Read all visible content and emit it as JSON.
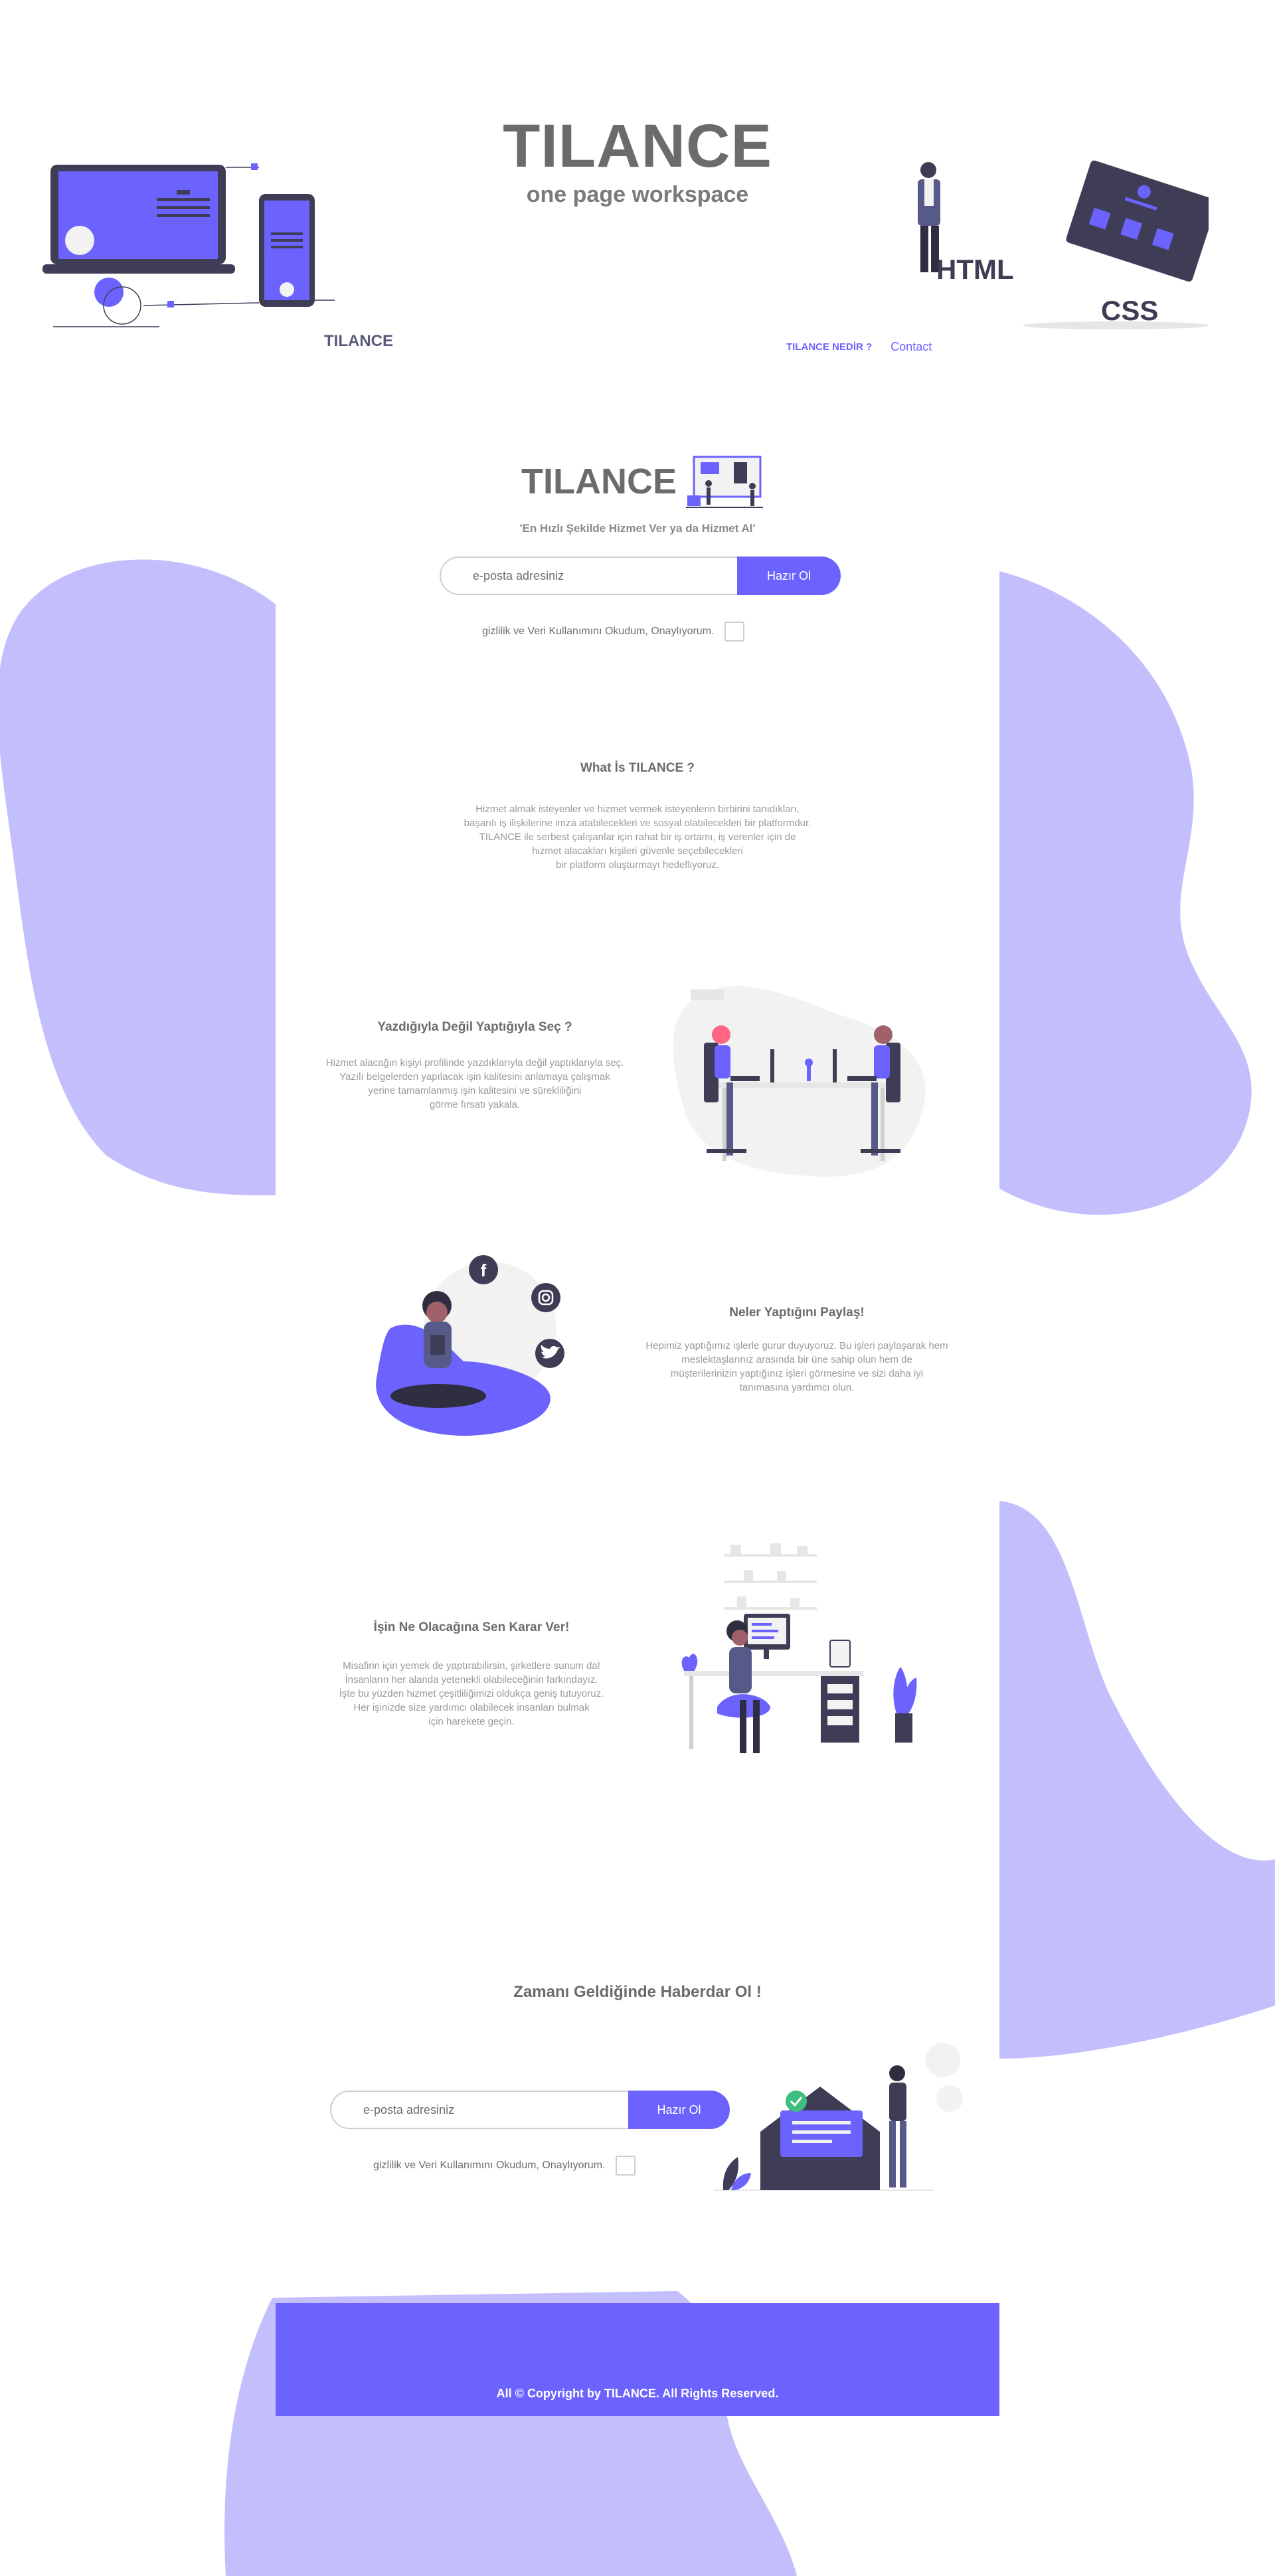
{
  "colors": {
    "accent": "#6c63ff",
    "blob": "#c3bffd",
    "dark": "#3f3d56",
    "title_grey": "#6b6b6b"
  },
  "header": {
    "title": "TILANCE",
    "subtitle": "one page workspace",
    "logo_text": "TILANCE",
    "nav": [
      {
        "label": "TILANCE NEDİR ?"
      },
      {
        "label": "Contact"
      }
    ],
    "illustration_left": "laptop-phone-illustration",
    "illustration_right": "html-css-illustration"
  },
  "hero": {
    "logo_text": "TILANCE",
    "tagline": "'En Hızlı Şekilde Hizmet Ver ya da Hizmet Al'",
    "email_placeholder": "e-posta adresiniz",
    "submit_label": "Hazır Ol",
    "consent_label": "gizlilik ve Veri Kullanımını Okudum, Onaylıyorum."
  },
  "what_is": {
    "title": "What İs TILANCE ?",
    "body": "Hizmet almak isteyenler ve hizmet vermek isteyenlerin birbirini tanıdıkları,\nbaşarılı iş ilişkilerine imza atabilecekleri ve sosyal olabilecekleri bir platformdur.\nTILANCE ile serbest çalışanlar için rahat bir iş ortamı, iş verenler için de\nhizmet alacakları kişileri güvenle seçebilecekleri\nbir platform oluşturmayı hedefliyoruz."
  },
  "feature1": {
    "title": "Yazdığıyla Değil Yaptığıyla Seç ?",
    "body": "Hizmet alacağın kişiyi profilinde yazdıklarıyla değil yaptıklarıyla seç.\nYazılı belgelerden yapılacak işin kalitesini anlamaya çalışmak\nyerine tamamlanmış  işin kalitesini ve sürekliliğini\ngörme fırsatı yakala."
  },
  "feature2": {
    "title": "Neler Yaptığını Paylaş!",
    "body": "Hepimiz yaptığımız işlerle gurur duyuyoruz. Bu işleri paylaşarak hem\nmeslektaşlarınız arasında bir üne sahip olun hem de\nmüşterilerinizin yaptığınız işleri görmesine ve sizi daha iyi\ntanımasına yardımcı olun."
  },
  "feature3": {
    "title": "İşin Ne Olacağına Sen Karar Ver!",
    "body": "Misafirin için yemek de yaptırabilirsin, şirketlere sunum da!\nİnsanların her alanda yetenekli olabileceğinin farkındayız.\nİşte bu yüzden hizmet çeşitliliğimizi oldukça geniş tutuyoruz.\nHer işinizde size yardımcı olabilecek insanları bulmak\niçin harekete geçin."
  },
  "notify": {
    "title": "Zamanı Geldiğinde Haberdar Ol !",
    "email_placeholder": "e-posta adresiniz",
    "submit_label": "Hazır Ol",
    "consent_label": "gizlilik ve Veri Kullanımını Okudum, Onaylıyorum."
  },
  "footer": {
    "copyright": "All © Copyright by TILANCE. All Rights Reserved."
  }
}
